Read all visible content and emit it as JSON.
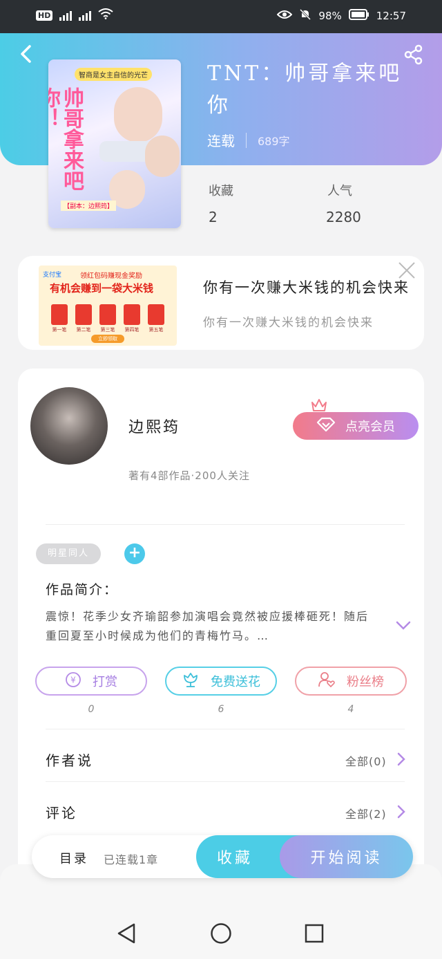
{
  "status_bar": {
    "left": "HD 2 4G 4G",
    "battery": "98%",
    "time": "12:57"
  },
  "book": {
    "title": "TNT：帅哥拿来吧你",
    "status": "连载",
    "word_count": "689字",
    "cover_lettering": {
      "tag": "智商是女主自信的光芒",
      "big": "帅哥拿来吧你！",
      "foot": "【副本：边熙筠】"
    }
  },
  "stats": {
    "favorites_label": "收藏",
    "favorites_value": "2",
    "popularity_label": "人气",
    "popularity_value": "2280"
  },
  "ad": {
    "title": "你有一次赚大米钱的机会快来",
    "subtitle": "你有一次赚大米钱的机会快来",
    "image": {
      "brand": "支付宝",
      "line1": "领红包码赚现金奖励",
      "line2": "有机会赚到一袋大米钱",
      "envelopes": [
        "第一笔",
        "第二笔",
        "第三笔",
        "第四笔",
        "第五笔"
      ],
      "button": "立即领取"
    }
  },
  "author": {
    "name": "边熙筠",
    "meta": "著有4部作品·200人关注",
    "vip_button": "点亮会员"
  },
  "tag": "明星同人",
  "intro": {
    "label": "作品简介：",
    "text": "震惊！花季少女齐瑜韶参加演唱会竟然被应援棒砸死！随后重回夏至小时候成为他们的青梅竹马。…"
  },
  "actions": [
    {
      "label": "打赏",
      "count": "0"
    },
    {
      "label": "免费送花",
      "count": "6"
    },
    {
      "label": "粉丝榜",
      "count": "4"
    }
  ],
  "rows": {
    "author_says": {
      "title": "作者说",
      "all": "全部(0)"
    },
    "comments": {
      "title": "评论",
      "all": "全部(2)"
    }
  },
  "bottom": {
    "toc": "目录",
    "toc_meta": "已连载1章",
    "favorite": "收藏",
    "start_reading": "开始阅读"
  },
  "colors": {
    "header_gradient_start": "#4ccde6",
    "header_gradient_end": "#b39de9",
    "accent_cyan": "#4ccde6",
    "vip_pink": "#f27b8a"
  }
}
